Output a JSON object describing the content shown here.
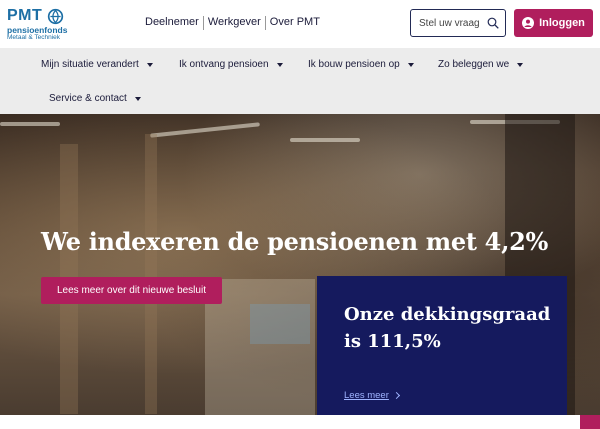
{
  "logo": {
    "brand": "PMT",
    "line1": "pensioenfonds",
    "line2": "Metaal & Techniek",
    "icon": "globe-mark-icon"
  },
  "audience_nav": [
    "Deelnemer",
    "Werkgever",
    "Over PMT"
  ],
  "search": {
    "placeholder": "Stel uw vraag",
    "icon": "search-icon"
  },
  "login": {
    "label": "Inloggen",
    "icon": "user-circle-icon"
  },
  "main_nav": [
    "Mijn situatie verandert",
    "Ik ontvang pensioen",
    "Ik bouw pensioen op",
    "Zo beleggen we",
    "Service & contact"
  ],
  "hero": {
    "headline": "We indexeren de pensioenen met 4,2%",
    "cta_label": "Lees meer over dit nieuwe besluit"
  },
  "card": {
    "title": "Onze dekkingsgraad is 111,5%",
    "link_label": "Lees meer"
  },
  "colors": {
    "brand_blue": "#1d6fa5",
    "accent": "#b01e5d",
    "card_bg": "#151a5e",
    "nav_bg": "#ececec"
  }
}
